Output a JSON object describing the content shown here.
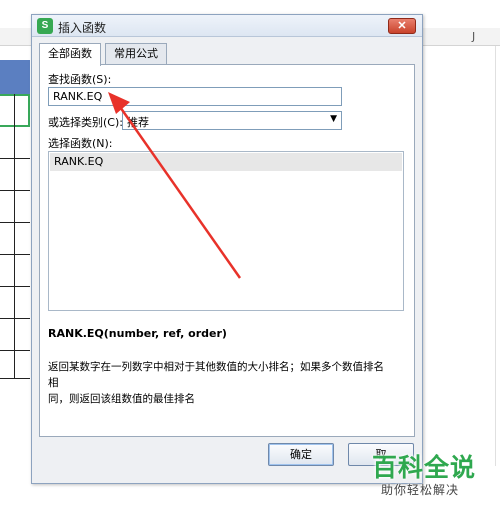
{
  "sheet": {
    "column_letter": "J",
    "accent_blue": "#5b7fc1",
    "selection_green": "#39a85a"
  },
  "dialog": {
    "title": "插入函数",
    "app_icon_letter": "S",
    "close_glyph": "✕",
    "tabs": [
      {
        "label": "全部函数",
        "active": true
      },
      {
        "label": "常用公式",
        "active": false
      }
    ],
    "search": {
      "label": "查找函数(S):",
      "value": "RANK.EQ"
    },
    "category": {
      "label": "或选择类别(C):",
      "value": "推荐"
    },
    "function_list": {
      "label": "选择函数(N):",
      "items": [
        "RANK.EQ"
      ],
      "selected": "RANK.EQ"
    },
    "syntax": "RANK.EQ(number, ref, order)",
    "description_line1": "返回某数字在一列数字中相对于其他数值的大小排名；如果多个数值排名相",
    "description_line2": "同，则返回该组数值的最佳排名",
    "buttons": {
      "ok": "确定",
      "cancel": "取"
    }
  },
  "annotation": {
    "arrow_color": "#e8322a"
  },
  "watermark": {
    "main": "百科全说",
    "sub": "助你轻松解决",
    "color": "#2fa84f"
  }
}
